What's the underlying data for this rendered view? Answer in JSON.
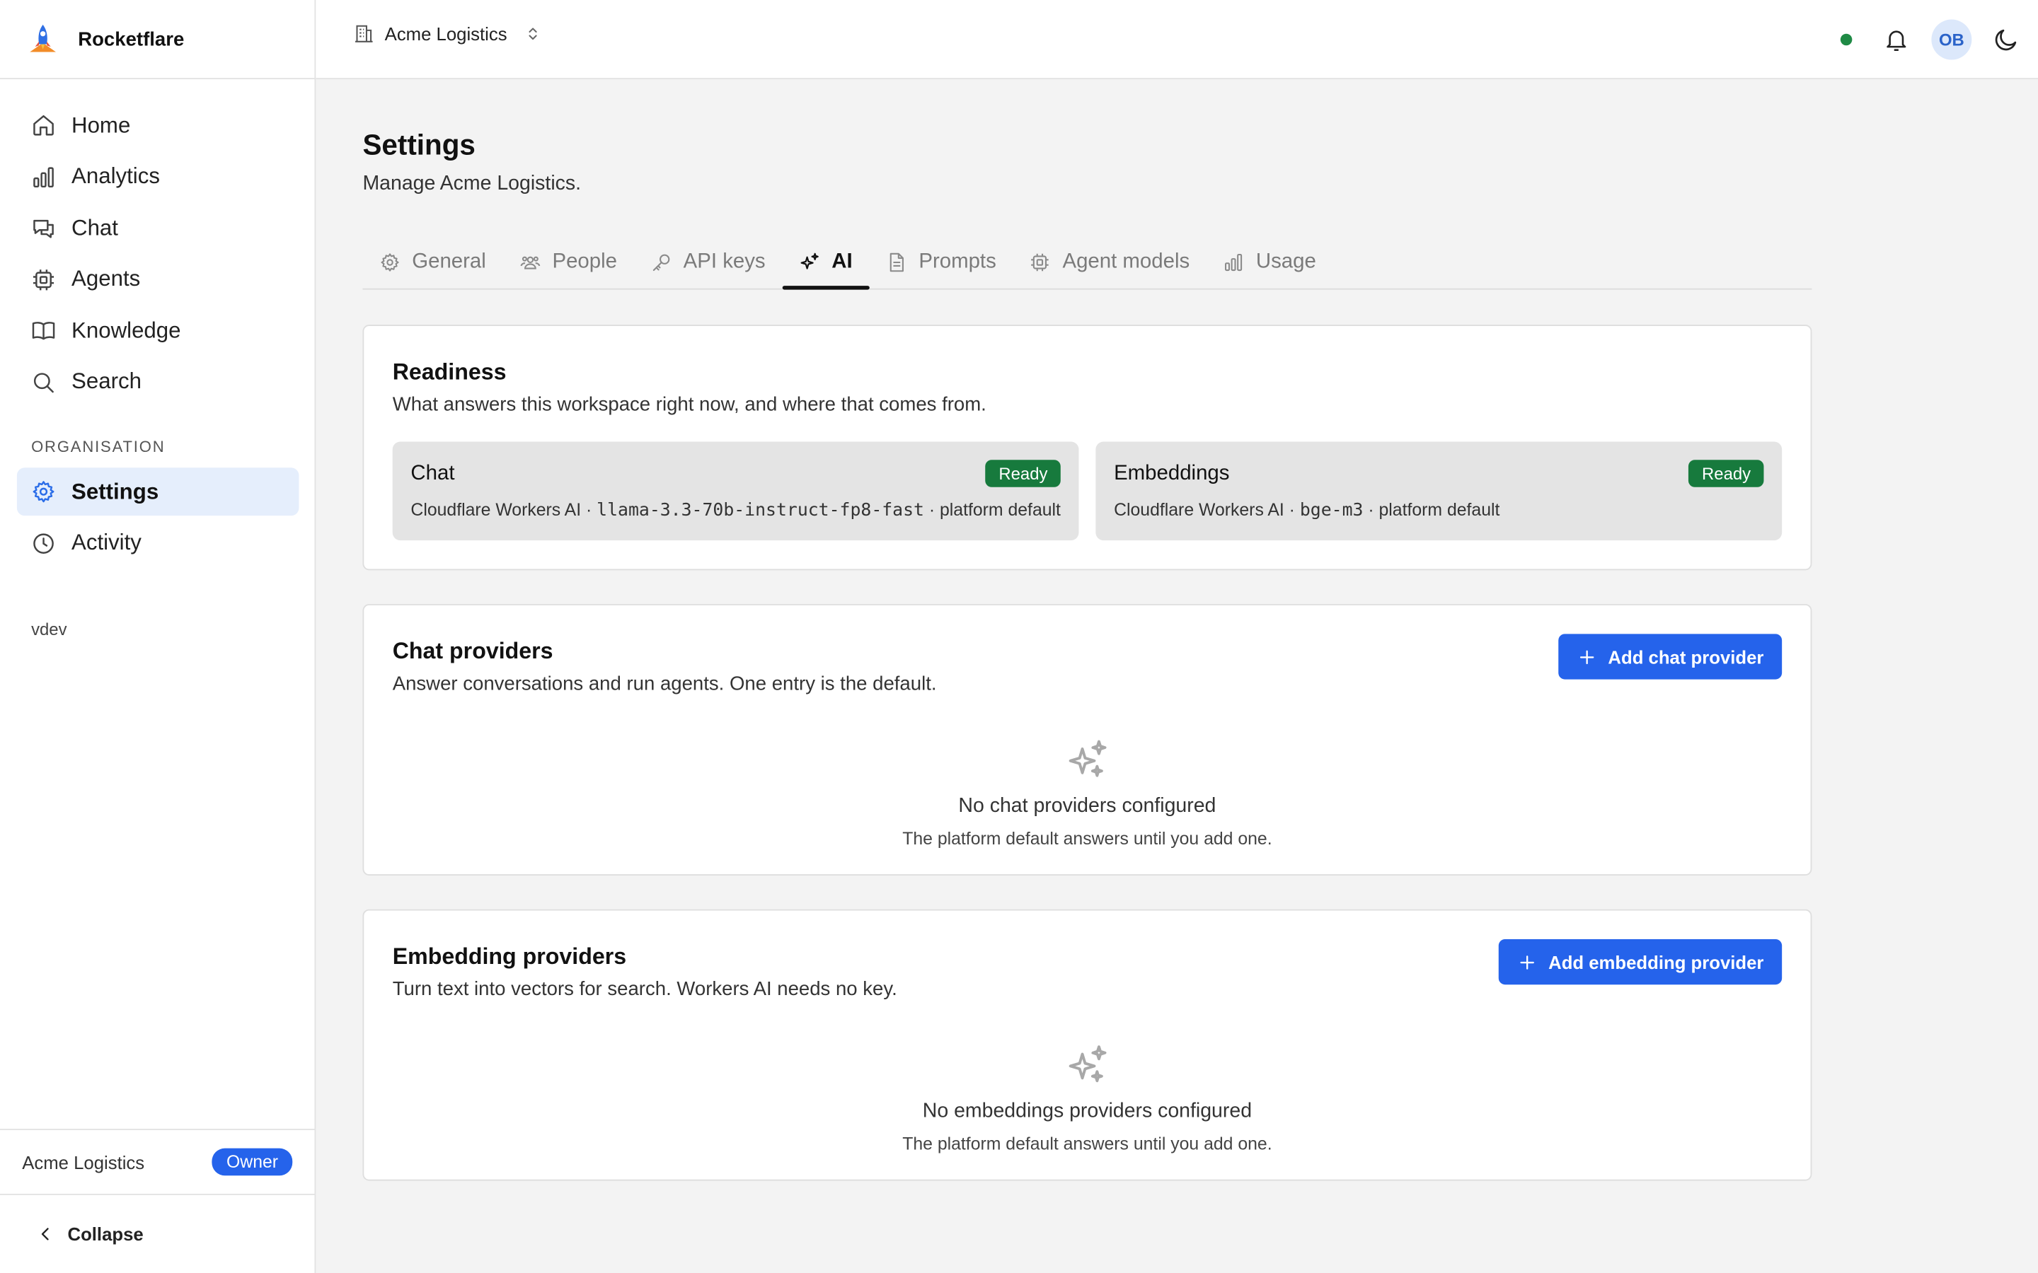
{
  "app": {
    "name": "Rocketflare"
  },
  "sidebar": {
    "items": [
      {
        "label": "Home",
        "icon": "home-icon"
      },
      {
        "label": "Analytics",
        "icon": "bar-chart-icon"
      },
      {
        "label": "Chat",
        "icon": "chat-icon"
      },
      {
        "label": "Agents",
        "icon": "cpu-icon"
      },
      {
        "label": "Knowledge",
        "icon": "book-icon"
      },
      {
        "label": "Search",
        "icon": "search-icon"
      }
    ],
    "section_label": "ORGANISATION",
    "org_items": [
      {
        "label": "Settings",
        "icon": "gear-icon",
        "active": true
      },
      {
        "label": "Activity",
        "icon": "clock-icon"
      }
    ],
    "environment": "vdev",
    "footer": {
      "org_name": "Acme Logistics",
      "role": "Owner"
    },
    "collapse_label": "Collapse"
  },
  "topbar": {
    "org_switcher": "Acme Logistics",
    "avatar_initials": "OB",
    "status_color": "#1f8a45"
  },
  "page": {
    "title": "Settings",
    "subtitle": "Manage Acme Logistics."
  },
  "tabs": [
    {
      "label": "General",
      "icon": "gear-icon"
    },
    {
      "label": "People",
      "icon": "users-icon"
    },
    {
      "label": "API keys",
      "icon": "key-icon"
    },
    {
      "label": "AI",
      "icon": "sparkles-icon",
      "active": true
    },
    {
      "label": "Prompts",
      "icon": "document-icon"
    },
    {
      "label": "Agent models",
      "icon": "cpu-icon"
    },
    {
      "label": "Usage",
      "icon": "bar-chart-icon"
    }
  ],
  "readiness": {
    "title": "Readiness",
    "subtitle": "What answers this workspace right now, and where that comes from.",
    "chat": {
      "title": "Chat",
      "status": "Ready",
      "provider": "Cloudflare Workers AI · ",
      "model": "llama-3.3-70b-instruct-fp8-fast",
      "source": " · platform default"
    },
    "embeddings": {
      "title": "Embeddings",
      "status": "Ready",
      "provider": "Cloudflare Workers AI · ",
      "model": "bge-m3",
      "source": " · platform default"
    }
  },
  "chat_providers": {
    "title": "Chat providers",
    "subtitle": "Answer conversations and run agents. One entry is the default.",
    "add_label": "Add chat provider",
    "empty_title": "No chat providers configured",
    "empty_sub": "The platform default answers until you add one."
  },
  "embedding_providers": {
    "title": "Embedding providers",
    "subtitle": "Turn text into vectors for search. Workers AI needs no key.",
    "add_label": "Add embedding provider",
    "empty_title": "No embeddings providers configured",
    "empty_sub": "The platform default answers until you add one."
  },
  "colors": {
    "accent": "#2563eb",
    "ready": "#177a3d",
    "active_nav_bg": "#e5eefc"
  }
}
